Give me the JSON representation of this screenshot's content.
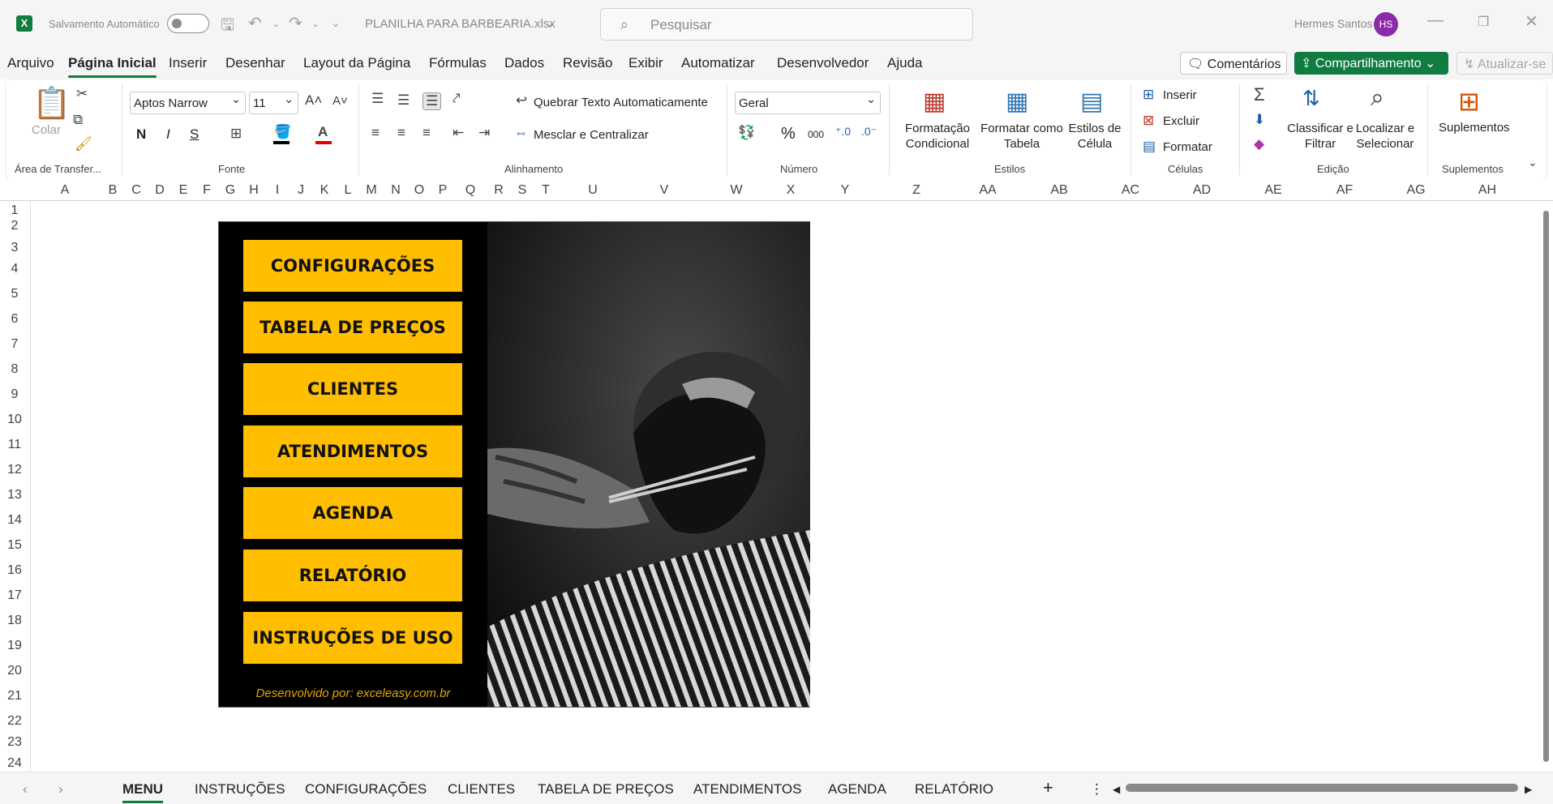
{
  "titlebar": {
    "app_icon": "excel-icon",
    "autosave_label": "Salvamento Automático",
    "filename": "PLANILHA PARA BARBEARIA.xlsx",
    "search_placeholder": "Pesquisar",
    "user_name": "Hermes Santos",
    "user_initials": "HS"
  },
  "menu": {
    "tabs": [
      "Arquivo",
      "Página Inicial",
      "Inserir",
      "Desenhar",
      "Layout da Página",
      "Fórmulas",
      "Dados",
      "Revisão",
      "Exibir",
      "Automatizar",
      "Desenvolvedor",
      "Ajuda"
    ],
    "active": "Página Inicial",
    "comments": "Comentários",
    "share": "Compartilhamento",
    "update": "Atualizar-se"
  },
  "ribbon": {
    "clipboard": {
      "paste": "Colar",
      "label": "Área de Transfer..."
    },
    "font": {
      "name": "Aptos Narrow",
      "size": "11",
      "bold": "N",
      "italic": "I",
      "underline": "S",
      "label": "Fonte"
    },
    "alignment": {
      "wrap": "Quebrar Texto Automaticamente",
      "merge": "Mesclar e Centralizar",
      "label": "Alinhamento"
    },
    "number": {
      "format": "Geral",
      "percent": "%",
      "thousands": "000",
      "label": "Número"
    },
    "styles": {
      "conditional": "Formatação Condicional",
      "format_table": "Formatar como Tabela",
      "cell_styles": "Estilos de Célula",
      "label": "Estilos"
    },
    "cells": {
      "insert": "Inserir",
      "delete": "Excluir",
      "format": "Formatar",
      "label": "Células"
    },
    "editing": {
      "sort": "Classificar e Filtrar",
      "find": "Localizar e Selecionar",
      "label": "Edição"
    },
    "addins": {
      "addins": "Suplementos",
      "label": "Suplementos"
    }
  },
  "columns": [
    "A",
    "B",
    "C",
    "D",
    "E",
    "F",
    "G",
    "H",
    "I",
    "J",
    "K",
    "L",
    "M",
    "N",
    "O",
    "P",
    "Q",
    "R",
    "S",
    "T",
    "U",
    "V",
    "W",
    "X",
    "Y",
    "Z",
    "AA",
    "AB",
    "AC",
    "AD",
    "AE",
    "AF",
    "AG",
    "AH"
  ],
  "rows": [
    "1",
    "2",
    "3",
    "4",
    "5",
    "6",
    "7",
    "8",
    "9",
    "10",
    "11",
    "12",
    "13",
    "14",
    "15",
    "16",
    "17",
    "18",
    "19",
    "20",
    "21",
    "22",
    "23",
    "24"
  ],
  "dashboard": {
    "buttons": [
      "CONFIGURAÇÕES",
      "TABELA DE PREÇOS",
      "CLIENTES",
      "ATENDIMENTOS",
      "AGENDA",
      "RELATÓRIO",
      "INSTRUÇÕES DE USO"
    ],
    "credit": "Desenvolvido por: exceleasy.com.br",
    "accent": "#ffbe00",
    "background": "#000000"
  },
  "sheets": [
    "MENU",
    "INSTRUÇÕES",
    "CONFIGURAÇÕES",
    "CLIENTES",
    "TABELA DE PREÇOS",
    "ATENDIMENTOS",
    "AGENDA",
    "RELATÓRIO"
  ],
  "active_sheet": "MENU"
}
